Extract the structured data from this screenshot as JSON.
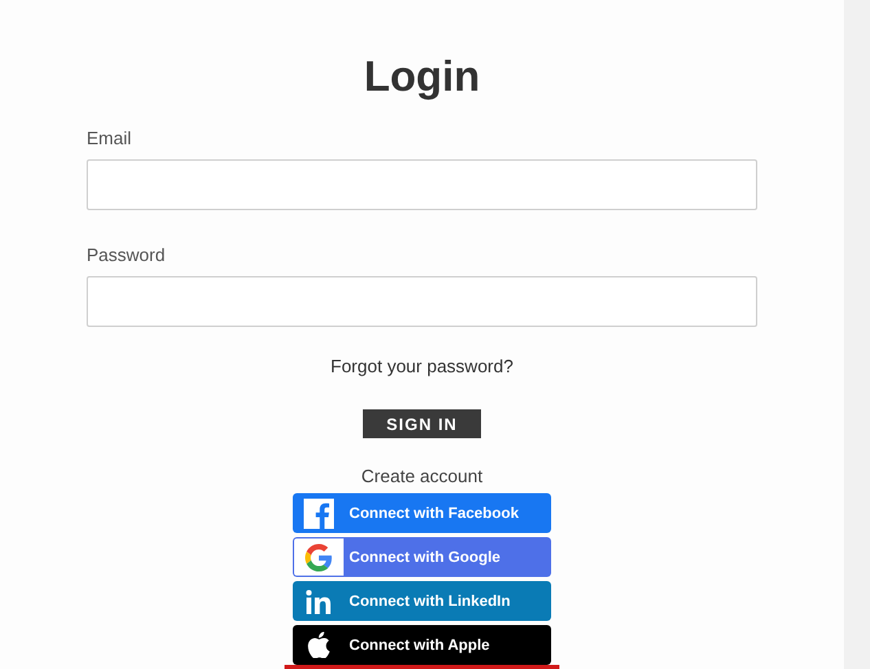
{
  "title": "Login",
  "fields": [
    {
      "label": "Email"
    },
    {
      "label": "Password"
    }
  ],
  "forgot_link": "Forgot your password?",
  "sign_in_button": "SIGN IN",
  "create_account_link": "Create account",
  "social_buttons": [
    {
      "kind": "facebook",
      "label": "Connect with Facebook",
      "color": "#1877f2"
    },
    {
      "kind": "google",
      "label": "Connect with Google",
      "color": "#4e70e8"
    },
    {
      "kind": "linkedin",
      "label": "Connect with LinkedIn",
      "color": "#0a7bb5"
    },
    {
      "kind": "apple",
      "label": "Connect with Apple",
      "color": "#000000"
    }
  ]
}
